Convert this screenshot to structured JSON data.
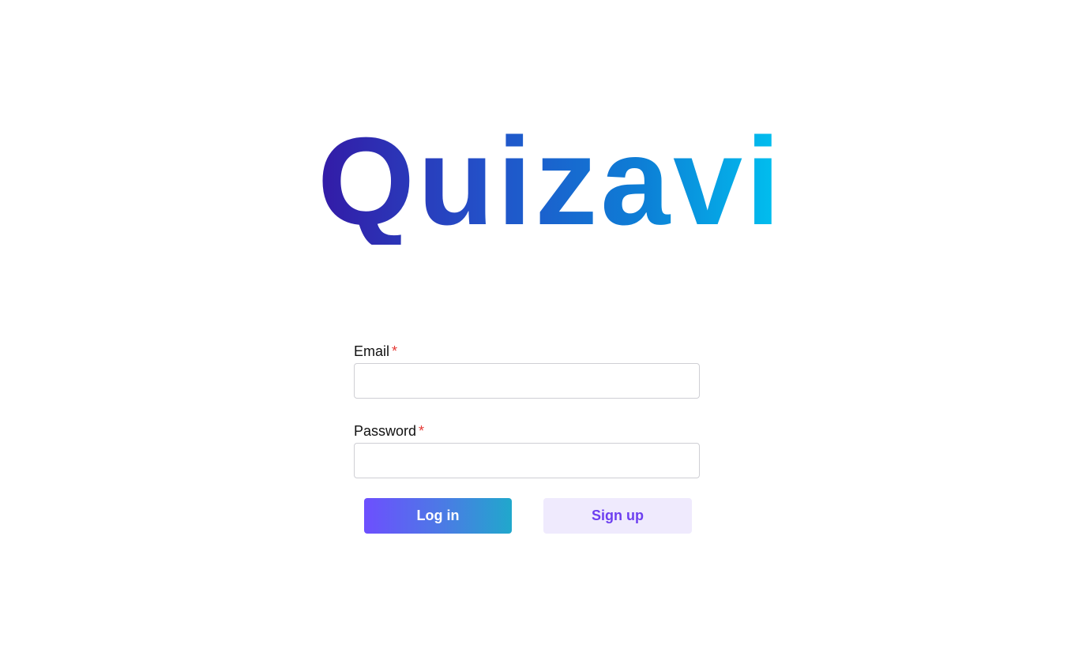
{
  "brand": {
    "name": "Quizavi"
  },
  "login_form": {
    "email": {
      "label": "Email",
      "required_marker": "*",
      "value": "",
      "placeholder": ""
    },
    "password": {
      "label": "Password",
      "required_marker": "*",
      "value": "",
      "placeholder": ""
    },
    "login_button_label": "Log in",
    "signup_button_label": "Sign up"
  },
  "colors": {
    "brand_gradient_start": "#331aa6",
    "brand_gradient_end": "#00c2f0",
    "login_gradient_start": "#6d4ffe",
    "login_gradient_end": "#20a8cc",
    "signup_text": "#6d3ff0",
    "signup_background": "#efeafd",
    "required_marker": "#e53935"
  }
}
